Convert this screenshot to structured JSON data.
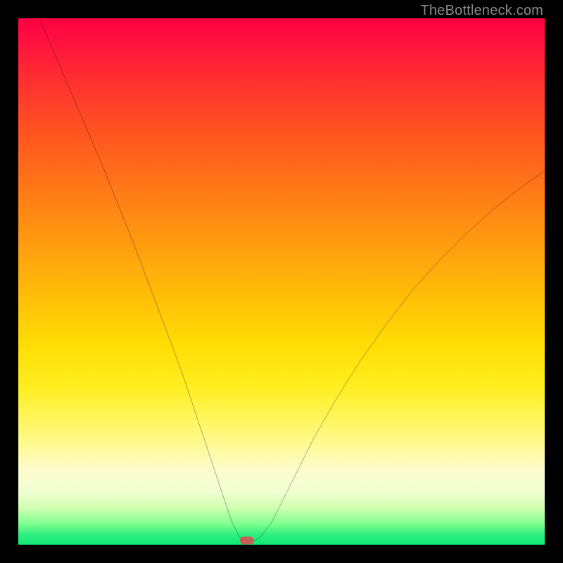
{
  "watermark": "TheBottleneck.com",
  "colors": {
    "frame": "#000000",
    "curve": "#000000",
    "marker": "#c56058"
  },
  "chart_data": {
    "type": "line",
    "title": "",
    "xlabel": "",
    "ylabel": "",
    "xlim": [
      0,
      100
    ],
    "ylim": [
      0,
      100
    ],
    "grid": false,
    "note": "No axes or tick labels are shown in the image; x/y are normalized 0–100. The curve is a V-shaped bottleneck profile with minimum near x≈43.",
    "series": [
      {
        "name": "bottleneck-curve",
        "x": [
          4,
          7,
          10,
          13,
          16,
          19,
          22,
          25,
          28,
          31,
          33,
          35,
          37,
          39,
          40.5,
          42,
          43,
          44,
          45,
          46,
          48,
          50,
          53,
          56,
          60,
          65,
          70,
          75,
          80,
          85,
          90,
          95,
          100
        ],
        "y": [
          100,
          93,
          86,
          79,
          72,
          64.5,
          57,
          49,
          41,
          33,
          27,
          21,
          15,
          9,
          4.5,
          1.5,
          0.5,
          0.5,
          0.8,
          1.5,
          4,
          8,
          14,
          20,
          27,
          35,
          42,
          48.5,
          54,
          59,
          63.5,
          67.5,
          71
        ]
      }
    ],
    "marker": {
      "x": 43.5,
      "y": 0.8,
      "shape": "rounded-rect"
    }
  }
}
